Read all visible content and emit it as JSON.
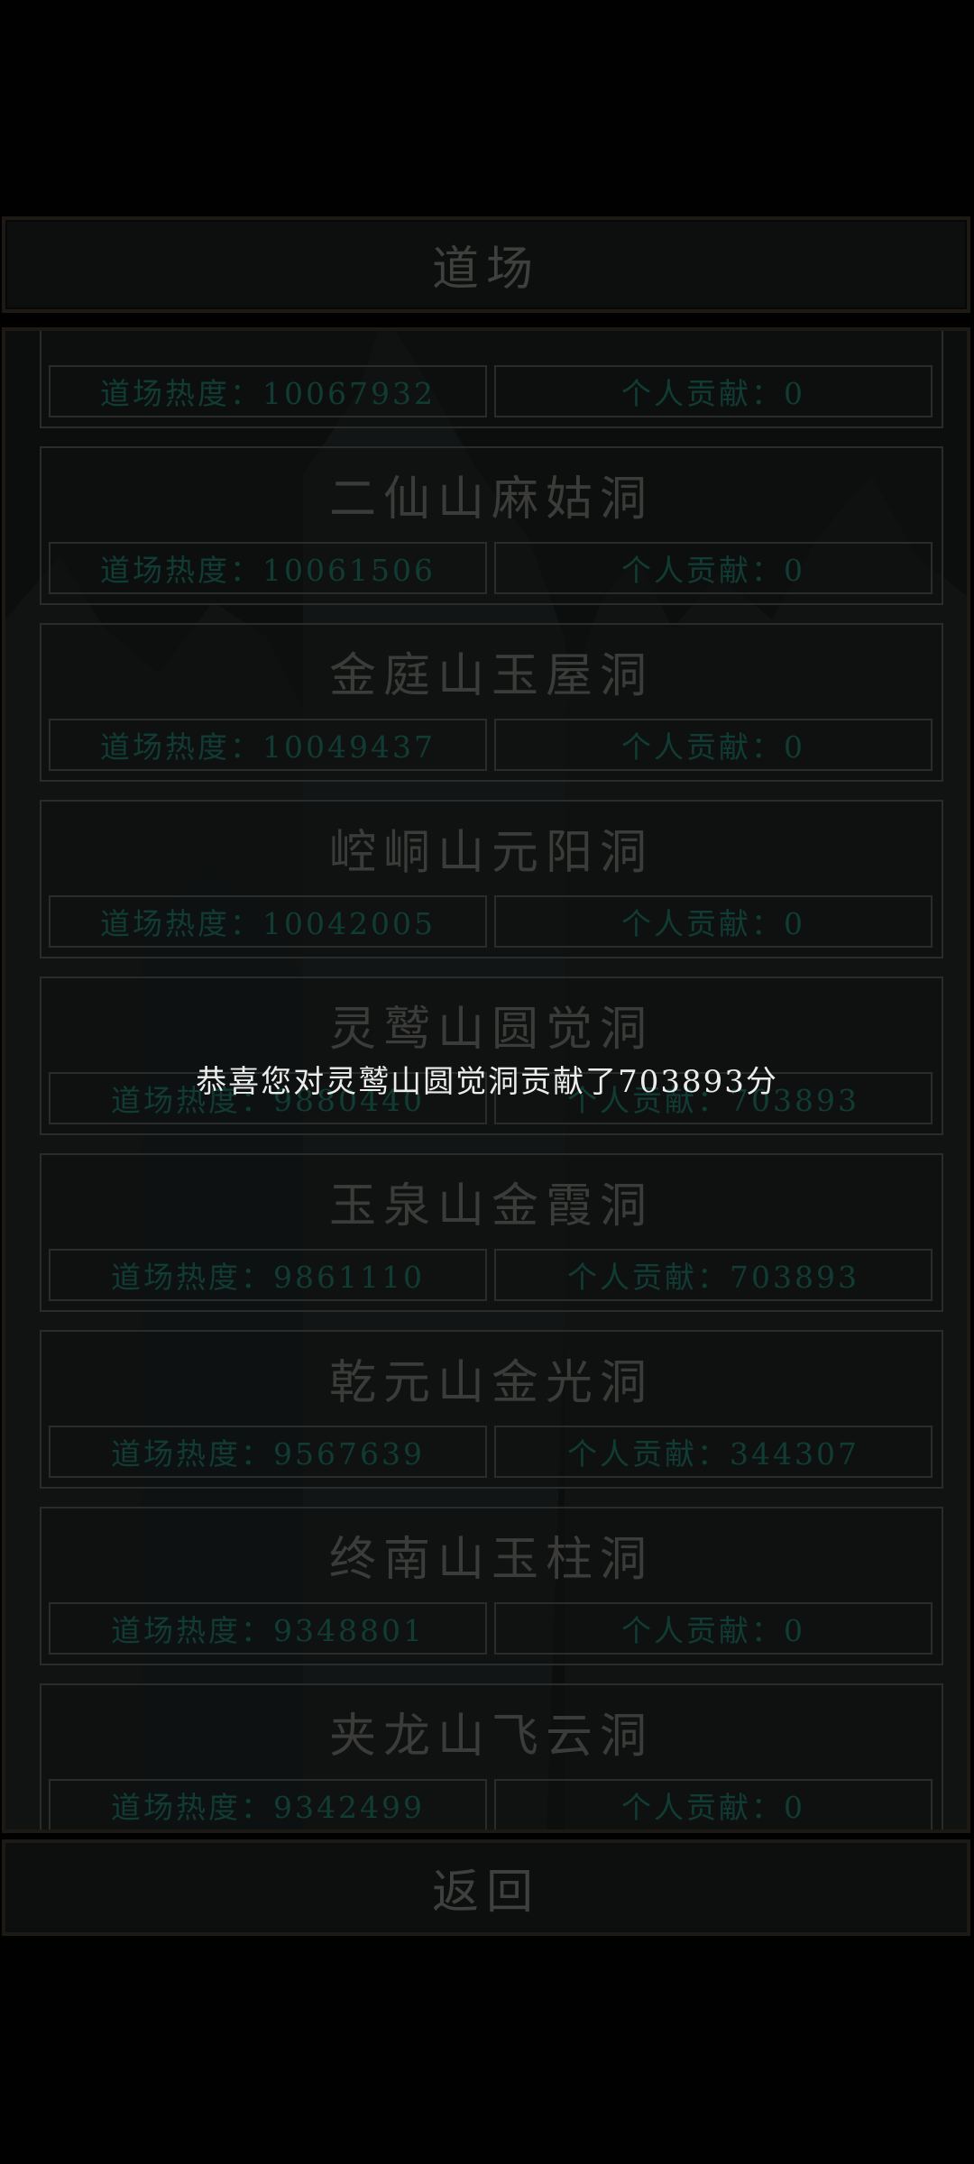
{
  "header": {
    "title": "道场"
  },
  "caves": [
    {
      "name": "",
      "heat_label": "道场热度：10067932",
      "contrib_label": "个人贡献：0"
    },
    {
      "name": "二仙山麻姑洞",
      "heat_label": "道场热度：10061506",
      "contrib_label": "个人贡献：0"
    },
    {
      "name": "金庭山玉屋洞",
      "heat_label": "道场热度：10049437",
      "contrib_label": "个人贡献：0"
    },
    {
      "name": "崆峒山元阳洞",
      "heat_label": "道场热度：10042005",
      "contrib_label": "个人贡献：0"
    },
    {
      "name": "灵鹫山圆觉洞",
      "heat_label": "道场热度：9880440",
      "contrib_label": "个人贡献：703893"
    },
    {
      "name": "玉泉山金霞洞",
      "heat_label": "道场热度：9861110",
      "contrib_label": "个人贡献：703893"
    },
    {
      "name": "乾元山金光洞",
      "heat_label": "道场热度：9567639",
      "contrib_label": "个人贡献：344307"
    },
    {
      "name": "终南山玉柱洞",
      "heat_label": "道场热度：9348801",
      "contrib_label": "个人贡献：0"
    },
    {
      "name": "夹龙山飞云洞",
      "heat_label": "道场热度：9342499",
      "contrib_label": "个人贡献：0"
    }
  ],
  "footer": {
    "back_label": "返回"
  },
  "toast": {
    "message": "恭喜您对灵鹫山圆觉洞贡献了703893分"
  }
}
